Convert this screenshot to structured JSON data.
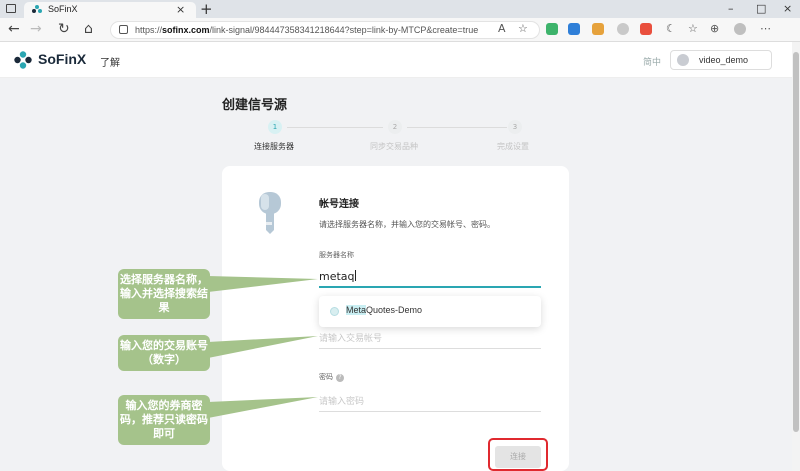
{
  "browser": {
    "tab_title": "SoFinX",
    "tab_close": "×",
    "new_tab": "+",
    "url_prefix": "https://",
    "url_domain": "sofinx.com",
    "url_path": "/link-signal/984447358341218644?step=link-by-MTCP&create=true",
    "window_controls": [
      "–",
      "□",
      "×"
    ]
  },
  "header": {
    "logo": "SoFinX",
    "nav_learn": "了解",
    "language": "简中",
    "username": "video_demo"
  },
  "page": {
    "title": "创建信号源",
    "steps": [
      {
        "number": "1",
        "label": "连接服务器"
      },
      {
        "number": "2",
        "label": "同步交易品种"
      },
      {
        "number": "3",
        "label": "完成设置"
      }
    ],
    "section_title": "帐号连接",
    "section_desc": "请选择服务器名称，并输入您的交易帐号、密码。",
    "server_label": "服务器名称",
    "server_value": "metaq",
    "suggestion_match": "Meta",
    "suggestion_rest": "Quotes-Demo",
    "account_placeholder": "请输入交易帐号",
    "password_label": "密码",
    "password_help": "?",
    "password_placeholder": "请输入密码",
    "confirm_label": "连接"
  },
  "callouts": [
    "选择服务器名称，输入并选择搜索结果",
    "输入您的交易账号（数字）",
    "输入您的券商密码，推荐只读密码即可"
  ],
  "colors": {
    "accent": "#2aa6b2",
    "callout": "#a5c38b",
    "highlight_box": "#e0292f"
  }
}
